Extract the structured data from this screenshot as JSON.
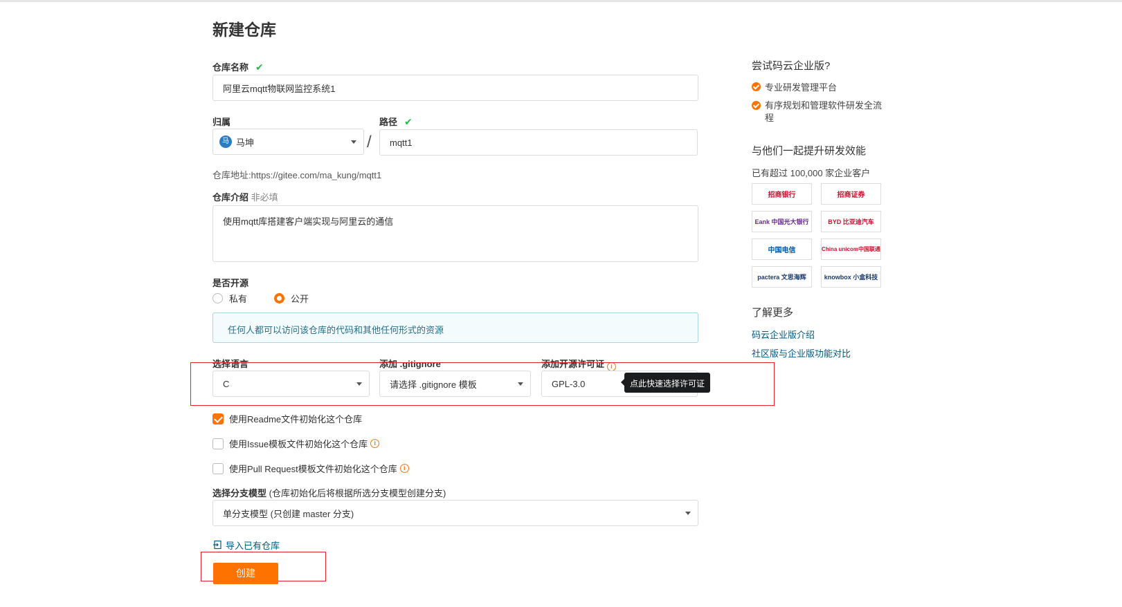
{
  "page": {
    "title": "新建仓库"
  },
  "form": {
    "name": {
      "label": "仓库名称",
      "value": "阿里云mqtt物联网监控系统1"
    },
    "owner": {
      "label": "归属",
      "avatar_text": "马",
      "value": "马坤"
    },
    "path": {
      "label": "路径",
      "value": "mqtt1",
      "separator": "/"
    },
    "address": {
      "label": "仓库地址:",
      "value": "https://gitee.com/ma_kung/mqtt1"
    },
    "intro": {
      "label": "仓库介绍",
      "optional": "非必填",
      "value": "使用mqtt库搭建客户端实现与阿里云的通信"
    },
    "visibility": {
      "label": "是否开源",
      "options": [
        "私有",
        "公开"
      ],
      "selected": "公开",
      "notice": "任何人都可以访问该仓库的代码和其他任何形式的资源"
    },
    "language": {
      "label": "选择语言",
      "value": "C"
    },
    "gitignore": {
      "label": "添加 .gitignore",
      "value": "请选择 .gitignore 模板"
    },
    "license": {
      "label": "添加开源许可证",
      "value": "GPL-3.0",
      "tooltip": "点此快速选择许可证"
    },
    "init_options": [
      {
        "label": "使用Readme文件初始化这个仓库",
        "checked": true
      },
      {
        "label": "使用Issue模板文件初始化这个仓库",
        "checked": false
      },
      {
        "label": "使用Pull Request模板文件初始化这个仓库",
        "checked": false
      }
    ],
    "branch": {
      "label": "选择分支模型",
      "hint": "(仓库初始化后将根据所选分支模型创建分支)",
      "value": "单分支模型 (只创建 master 分支)"
    },
    "import_link": "导入已有仓库",
    "submit": "创建"
  },
  "sidebar": {
    "enterprise_title": "尝试码云企业版?",
    "features": [
      "专业研发管理平台",
      "有序规划和管理软件研发全流程"
    ],
    "together_title": "与他们一起提升研发效能",
    "customers": "已有超过 100,000 家企业客户",
    "logos": [
      {
        "text": "招商银行",
        "color": "#c8102e"
      },
      {
        "text": "招商证券",
        "color": "#c8102e"
      },
      {
        "text": "Eank 中国光大银行",
        "color": "#6a2c8e"
      },
      {
        "text": "BYD 比亚迪汽车",
        "color": "#c8102e"
      },
      {
        "text": "中国电信",
        "color": "#005bac"
      },
      {
        "text": "China unicom中国联通",
        "color": "#c8102e"
      },
      {
        "text": "pactera 文思海辉",
        "color": "#1b3a6b"
      },
      {
        "text": "knowbox 小盒科技",
        "color": "#1b3a6b"
      }
    ],
    "more_title": "了解更多",
    "links": [
      "码云企业版介绍",
      "社区版与企业版功能对比"
    ]
  }
}
